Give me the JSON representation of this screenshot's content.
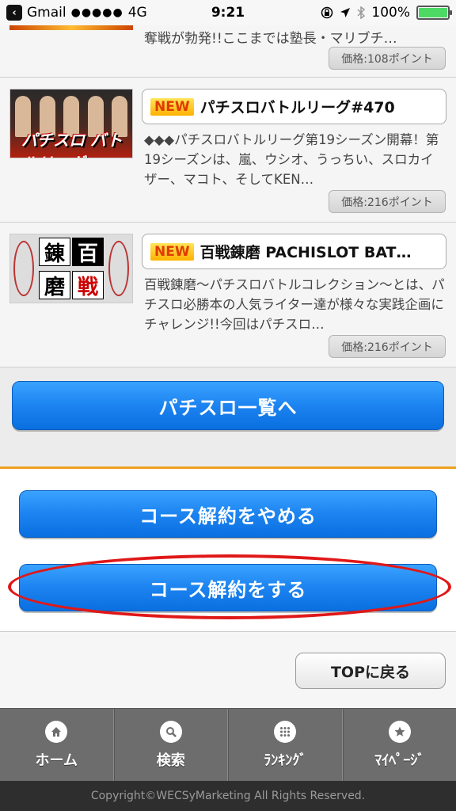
{
  "status_bar": {
    "back_app": "Gmail",
    "signal": "●●●●●",
    "network": "4G",
    "time": "9:21",
    "battery_percent": "100%",
    "battery_level": 1.0,
    "battery_color": "#4cd964"
  },
  "list": {
    "partial_item": {
      "description": "奪戦が勃発!!ここまでは塾長・マリブチ…",
      "price": "価格:108ポイント"
    },
    "items": [
      {
        "badge": "NEW",
        "title": "パチスロバトルリーグ#470",
        "description": "◆◆◆パチスロバトルリーグ第19シーズン開幕！第19シーズンは、嵐、ウシオ、うっちい、スロカイザー、マコト、そしてKEN…",
        "price": "価格:216ポイント",
        "thumb_text": "パチスロ バトルリーグ"
      },
      {
        "badge": "NEW",
        "title": "百戦錬磨 PACHISLOT BAT…",
        "description": "百戦錬磨〜パチスロバトルコレクション〜とは、パチスロ必勝本の人気ライター達が様々な実践企画にチャレンジ!!今回はパチスロ…",
        "price": "価格:216ポイント",
        "thumb_kanji": [
          "錬",
          "百",
          "磨",
          "戦"
        ]
      }
    ]
  },
  "buttons": {
    "list_label": "パチスロ一覧へ",
    "stop_cancel_label": "コース解約をやめる",
    "cancel_label": "コース解約をする",
    "top_label": "TOPに戻る"
  },
  "tabs": [
    {
      "label": "ホーム",
      "icon": "home-icon"
    },
    {
      "label": "検索",
      "icon": "search-icon"
    },
    {
      "label": "ﾗﾝｷﾝｸﾞ",
      "icon": "grid-icon"
    },
    {
      "label": "ﾏｲﾍﾟｰｼﾞ",
      "icon": "star-icon"
    }
  ],
  "footer": {
    "copyright": "Copyright©WECSyMarketing All Rights Reserved."
  },
  "colors": {
    "accent_blue": "#1c83f0",
    "divider_orange": "#f0a020",
    "highlight_red": "#e01818",
    "new_badge": "#ffb200"
  }
}
